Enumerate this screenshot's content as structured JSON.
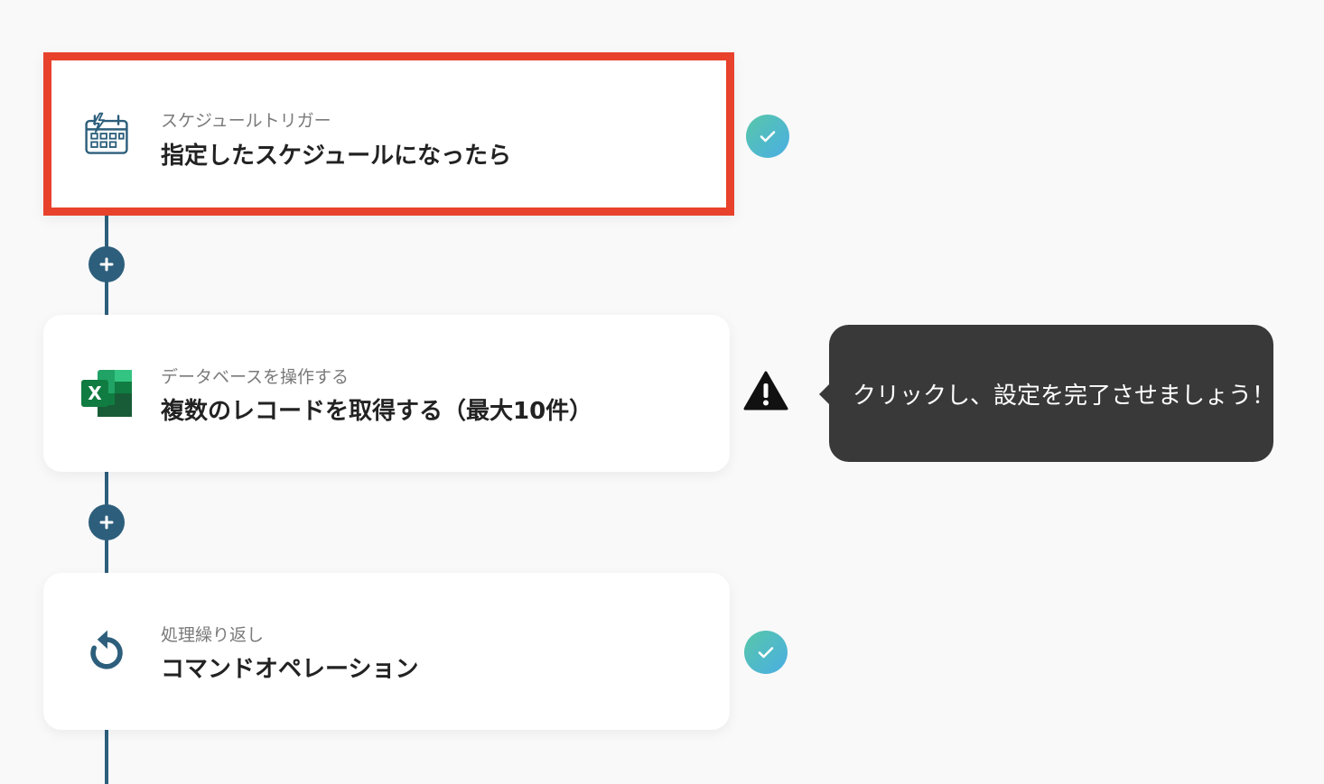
{
  "steps": [
    {
      "subtitle": "スケジュールトリガー",
      "title": "指定したスケジュールになったら",
      "status": "complete",
      "icon": "schedule-calendar-icon"
    },
    {
      "subtitle": "データベースを操作する",
      "title": "複数のレコードを取得する（最大10件）",
      "status": "warning",
      "icon": "excel-icon"
    },
    {
      "subtitle": "処理繰り返し",
      "title": "コマンドオペレーション",
      "status": "complete",
      "icon": "loop-icon"
    }
  ],
  "tooltip": {
    "text": "クリックし、設定を完了させましょう！"
  },
  "excel": {
    "letter": "X"
  },
  "colors": {
    "selected_border": "#e8412c",
    "connector": "#2d5f7c",
    "check_gradient_start": "#58c7a8",
    "check_gradient_end": "#4aaee4",
    "tooltip_bg": "#393939"
  }
}
